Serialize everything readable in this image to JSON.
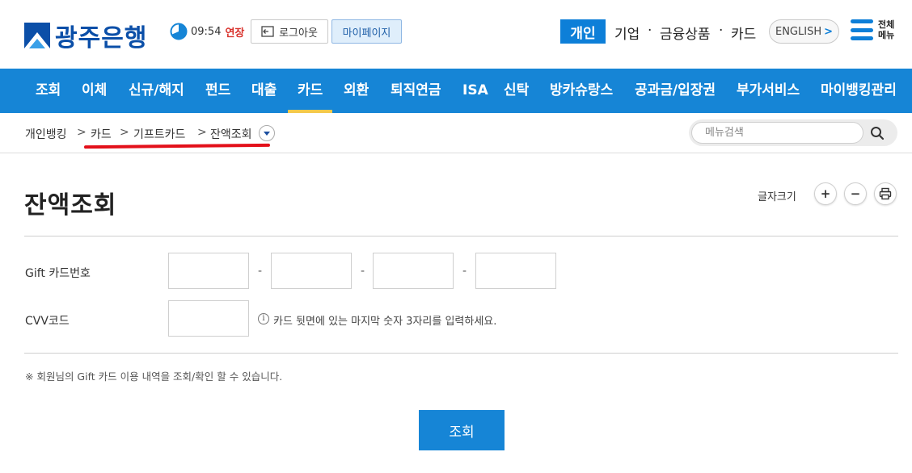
{
  "header": {
    "logo_text": "광주은행",
    "session_time": "09:54",
    "extend_label": "연장",
    "logout_label": "로그아웃",
    "mypage_label": "마이페이지",
    "categories": {
      "personal": "개인",
      "corporate": "기업",
      "separator": "·",
      "financial_products": "금융상품",
      "card": "카드"
    },
    "english_label": "ENGLISH",
    "english_arrow": ">",
    "all_menu_label": "전체 메뉴",
    "brand_color": "#0b4fa8",
    "accent_color": "#1685d6"
  },
  "gnb": {
    "items": [
      "조회",
      "이체",
      "신규/해지",
      "펀드",
      "대출",
      "카드",
      "외환",
      "퇴직연금",
      "ISA",
      "신탁",
      "방카슈랑스",
      "공과금/입장권",
      "부가서비스",
      "마이뱅킹관리"
    ],
    "active": "카드",
    "active_indicator_color": "#f4c94c"
  },
  "breadcrumb": {
    "items": [
      "개인뱅킹",
      "카드",
      "기프트카드",
      "잔액조회"
    ],
    "separator": ">",
    "highlight_color": "#e3101a"
  },
  "menu_search": {
    "placeholder": "메뉴검색",
    "icon": "search-icon"
  },
  "page": {
    "title": "잔액조회",
    "font_size_label": "글자크기",
    "font_increase": "+",
    "font_decrease": "−",
    "print_icon": "print-icon"
  },
  "form": {
    "card_number_label": "Gift 카드번호",
    "card_number_values": [
      "",
      "",
      "",
      ""
    ],
    "dash": "-",
    "cvv_label": "CVV코드",
    "cvv_value": "",
    "info_symbol": "i",
    "cvv_help": "카드 뒷면에 있는 마지막 숫자 3자리를 입력하세요.",
    "notice": "※ 회원님의 Gift 카드 이용 내역을 조회/확인 할 수 있습니다.",
    "submit_label": "조회"
  }
}
